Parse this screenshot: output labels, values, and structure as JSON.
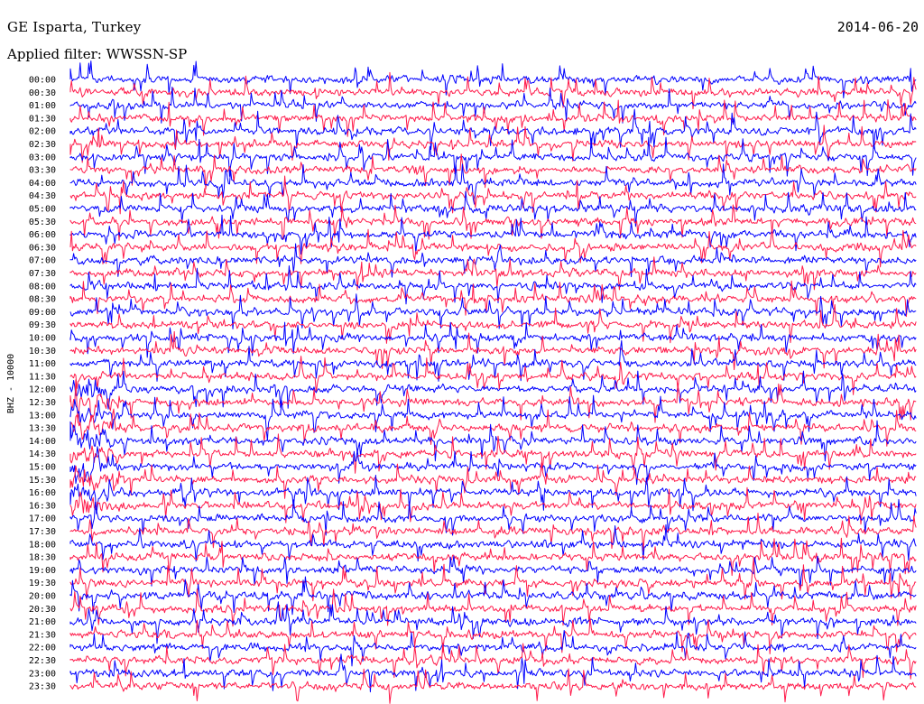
{
  "header": {
    "station": "GE Isparta, Turkey",
    "date": "2014-06-20",
    "filter": "Applied filter: WWSSN-SP"
  },
  "chart_data": {
    "type": "line",
    "chart_kind": "helicorder",
    "ylabel": "BHZ - 10000",
    "row_labels": [
      "00:00",
      "00:30",
      "01:00",
      "01:30",
      "02:00",
      "02:30",
      "03:00",
      "03:30",
      "04:00",
      "04:30",
      "05:00",
      "05:30",
      "06:00",
      "06:30",
      "07:00",
      "07:30",
      "08:00",
      "08:30",
      "09:00",
      "09:30",
      "10:00",
      "10:30",
      "11:00",
      "11:30",
      "12:00",
      "12:30",
      "13:00",
      "13:30",
      "14:00",
      "14:30",
      "15:00",
      "15:30",
      "16:00",
      "16:30",
      "17:00",
      "17:30",
      "18:00",
      "18:30",
      "19:00",
      "19:30",
      "20:00",
      "20:30",
      "21:00",
      "21:30",
      "22:00",
      "22:30",
      "23:00",
      "23:30"
    ],
    "row_minutes": 30,
    "trace_colors": [
      "#0000ff",
      "#ff1a4a"
    ],
    "grid": false,
    "event_rows": [
      "12:00",
      "12:30",
      "13:00",
      "13:30",
      "14:00",
      "14:30",
      "15:00",
      "15:30",
      "16:00",
      "16:30"
    ]
  }
}
